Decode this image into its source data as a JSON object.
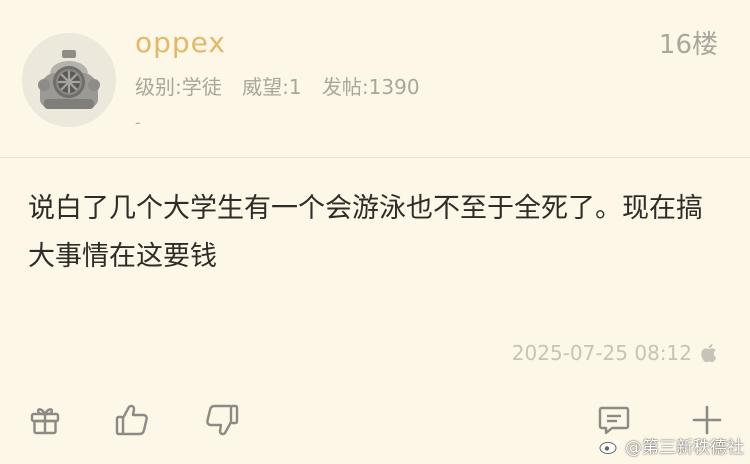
{
  "post": {
    "username": "oppex",
    "floor": "16楼",
    "meta": {
      "level": "级别:学徒",
      "prestige": "威望:1",
      "posts": "发帖:1390"
    },
    "signature": "-",
    "content": "说白了几个大学生有一个会游泳也不至于全死了。现在搞大事情在这要钱",
    "timestamp": "2025-07-25 08:12",
    "device_icon": "apple-icon"
  },
  "actions": [
    "gift-icon",
    "thumbs-up-icon",
    "thumbs-down-icon",
    "comment-icon",
    "plus-icon"
  ],
  "watermark": "@第三新秩德社",
  "colors": {
    "background": "#fcf7e6",
    "username": "#e3b868",
    "meta": "#a9a69c",
    "content": "#2e2c28",
    "icon": "#8b8a85"
  }
}
